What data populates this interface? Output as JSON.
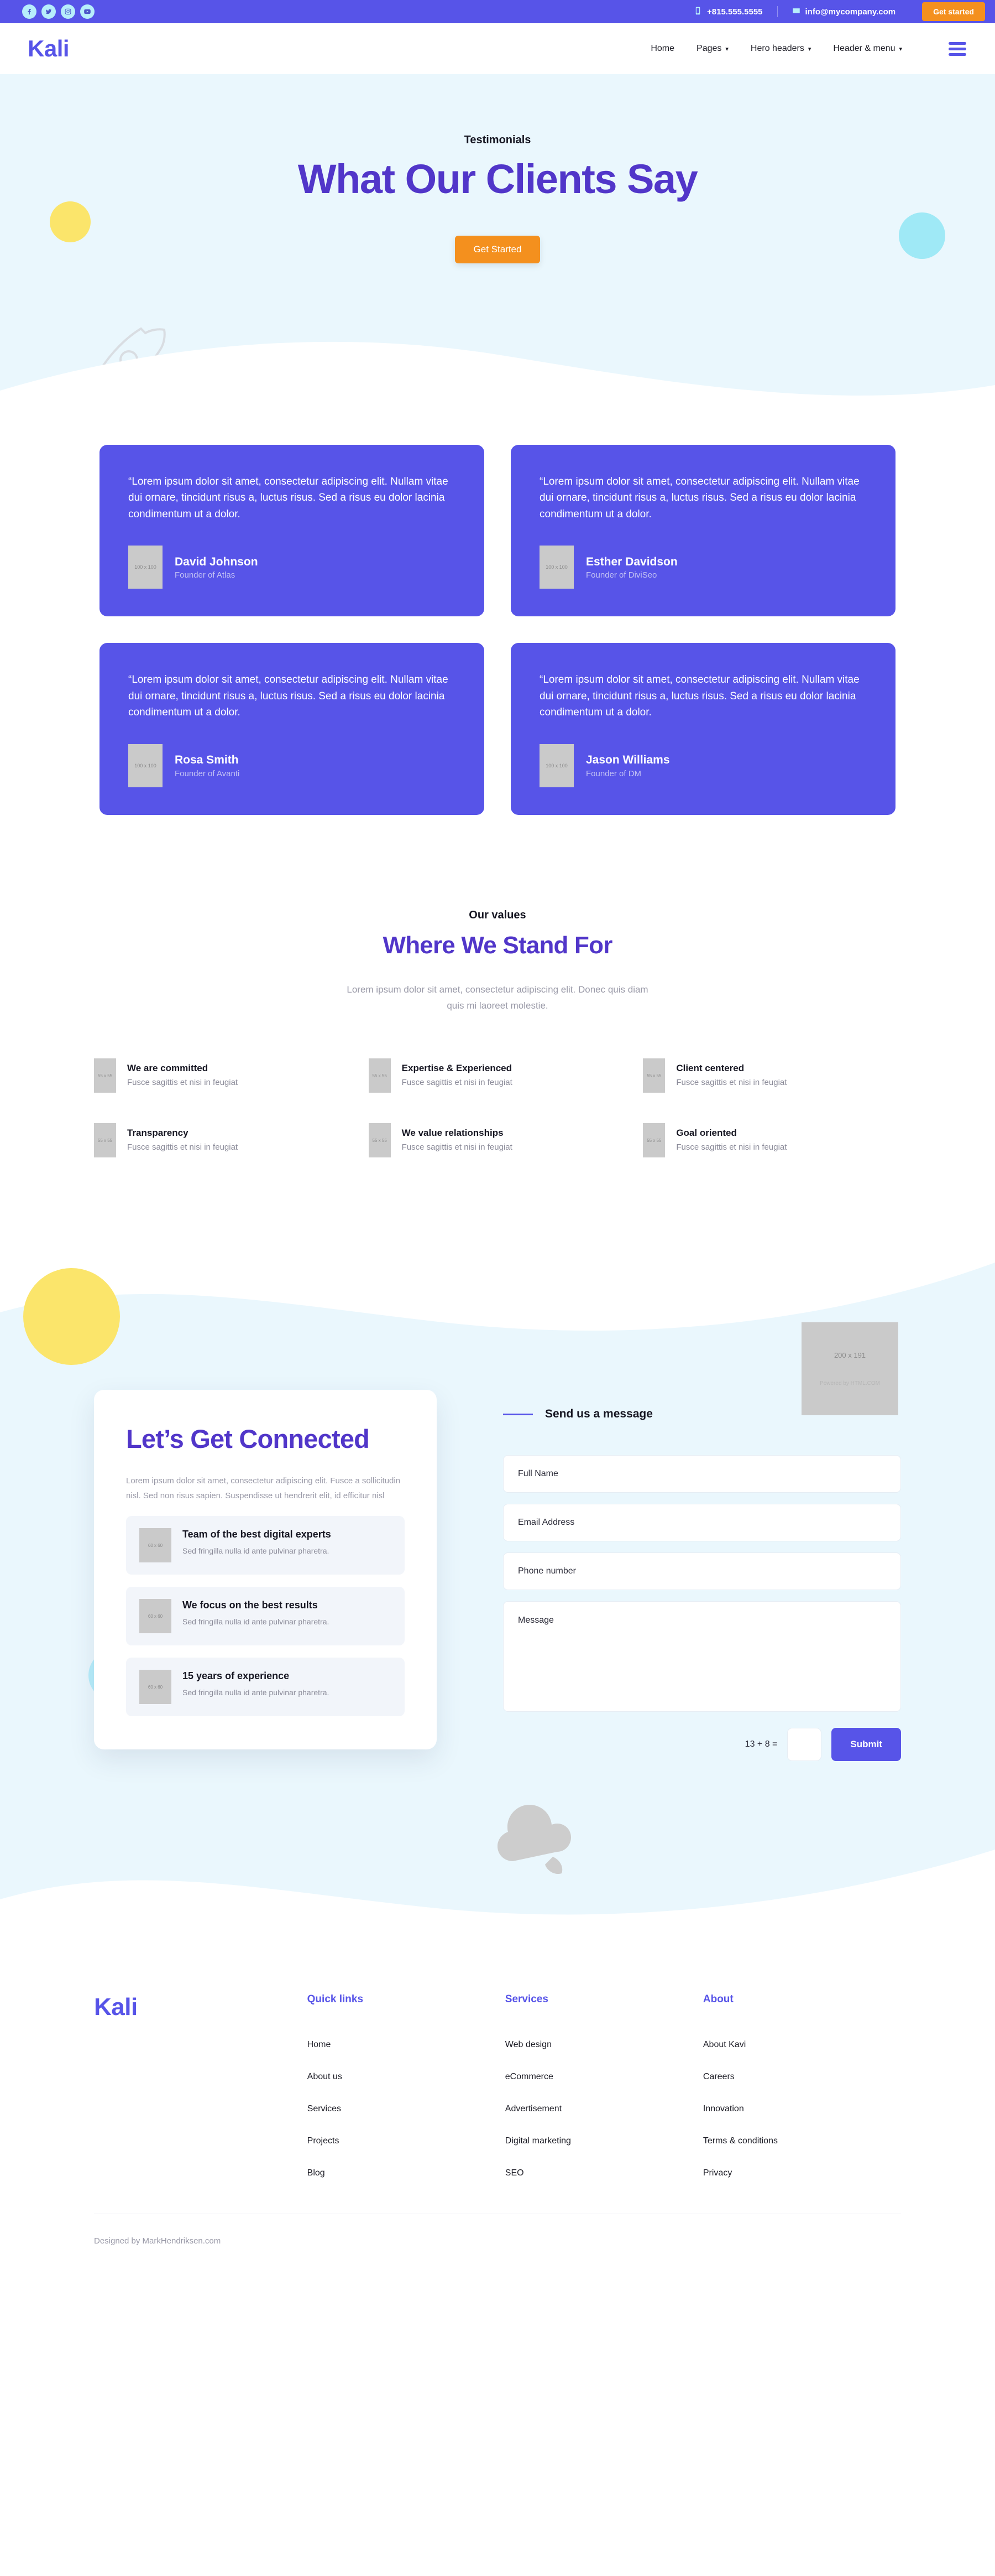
{
  "topbar": {
    "social": [
      {
        "name": "facebook-icon",
        "label": "Facebook"
      },
      {
        "name": "twitter-icon",
        "label": "Twitter"
      },
      {
        "name": "instagram-icon",
        "label": "Instagram"
      },
      {
        "name": "youtube-icon",
        "label": "YouTube"
      }
    ],
    "phone": "+815.555.5555",
    "email": "info@mycompany.com",
    "cta": "Get started",
    "accent_orange": "#f4901e",
    "bar_purple": "#5754e8"
  },
  "nav": {
    "logo": "Kali",
    "links": [
      {
        "label": "Home",
        "caret": false
      },
      {
        "label": "Pages",
        "caret": true
      },
      {
        "label": "Hero headers",
        "caret": true
      },
      {
        "label": "Header & menu",
        "caret": true
      }
    ],
    "menu_icon": "hamburger-menu-icon"
  },
  "hero": {
    "eyebrow": "Testimonials",
    "title": "What Our Clients Say",
    "cta": "Get Started",
    "bg": "#eaf7fd",
    "title_color": "#5136c9"
  },
  "testimonials": [
    {
      "quote": "“Lorem ipsum dolor sit amet, consectetur adipiscing elit. Nullam vitae dui ornare, tincidunt risus a, luctus risus. Sed a risus eu dolor lacinia condimentum ut a dolor.",
      "avatar": "100 x 100",
      "name": "David Johnson",
      "role": "Founder of Atlas"
    },
    {
      "quote": "“Lorem ipsum dolor sit amet, consectetur adipiscing elit. Nullam vitae dui ornare, tincidunt risus a, luctus risus. Sed a risus eu dolor lacinia condimentum ut a dolor.",
      "avatar": "100 x 100",
      "name": "Esther Davidson",
      "role": "Founder of DiviSeo"
    },
    {
      "quote": "“Lorem ipsum dolor sit amet, consectetur adipiscing elit. Nullam vitae dui ornare, tincidunt risus a, luctus risus. Sed a risus eu dolor lacinia condimentum ut a dolor.",
      "avatar": "100 x 100",
      "name": "Rosa Smith",
      "role": "Founder of Avanti"
    },
    {
      "quote": "“Lorem ipsum dolor sit amet, consectetur adipiscing elit. Nullam vitae dui ornare, tincidunt risus a, luctus risus. Sed a risus eu dolor lacinia condimentum ut a dolor.",
      "avatar": "100 x 100",
      "name": "Jason Williams",
      "role": "Founder of DM"
    }
  ],
  "values": {
    "eyebrow": "Our values",
    "title": "Where We Stand For",
    "subtitle": "Lorem ipsum dolor sit amet, consectetur adipiscing elit. Donec quis diam quis mi laoreet molestie.",
    "items": [
      {
        "icon": "55 x 55",
        "title": "We are committed",
        "desc": "Fusce sagittis et nisi in feugiat"
      },
      {
        "icon": "55 x 55",
        "title": "Expertise & Experienced",
        "desc": "Fusce sagittis et nisi in feugiat"
      },
      {
        "icon": "55 x 55",
        "title": "Client centered",
        "desc": "Fusce sagittis et nisi in feugiat"
      },
      {
        "icon": "55 x 55",
        "title": "Transparency",
        "desc": "Fusce sagittis et nisi in feugiat"
      },
      {
        "icon": "55 x 55",
        "title": "We value relationships",
        "desc": "Fusce sagittis et nisi in feugiat"
      },
      {
        "icon": "55 x 55",
        "title": "Goal oriented",
        "desc": "Fusce sagittis et nisi in feugiat"
      }
    ]
  },
  "contact": {
    "image_placeholder": {
      "size": "200 x 191",
      "powered": "Powered by HTML.COM"
    },
    "card": {
      "title": "Let’s Get Connected",
      "desc": "Lorem ipsum dolor sit amet, consectetur adipiscing elit. Fusce a sollicitudin nisl. Sed non risus sapien. Suspendisse ut hendrerit elit, id efficitur nisl",
      "features": [
        {
          "icon": "60 x 60",
          "title": "Team of the best digital experts",
          "desc": "Sed fringilla nulla id ante pulvinar pharetra."
        },
        {
          "icon": "60 x 60",
          "title": "We focus on the best results",
          "desc": "Sed fringilla nulla id ante pulvinar pharetra."
        },
        {
          "icon": "60 x 60",
          "title": "15 years of experience",
          "desc": "Sed fringilla nulla id ante pulvinar pharetra."
        }
      ]
    },
    "form": {
      "heading": "Send us a message",
      "fields": [
        {
          "name": "full-name",
          "placeholder": "Full Name",
          "value": ""
        },
        {
          "name": "email-address",
          "placeholder": "Email Address",
          "value": ""
        },
        {
          "name": "phone-number",
          "placeholder": "Phone number",
          "value": ""
        }
      ],
      "message_placeholder": "Message",
      "message_value": "",
      "captcha_label": "13 + 8 =",
      "captcha_value": "",
      "submit": "Submit"
    }
  },
  "footer": {
    "logo": "Kali",
    "columns": [
      {
        "heading": "Quick links",
        "links": [
          "Home",
          "About us",
          "Services",
          "Projects",
          "Blog"
        ]
      },
      {
        "heading": "Services",
        "links": [
          "Web design",
          "eCommerce",
          "Advertisement",
          "Digital marketing",
          "SEO"
        ]
      },
      {
        "heading": "About",
        "links": [
          "About Kavi",
          "Careers",
          "Innovation",
          "Terms & conditions",
          "Privacy"
        ]
      }
    ],
    "credit": "Designed by MarkHendriksen.com"
  }
}
